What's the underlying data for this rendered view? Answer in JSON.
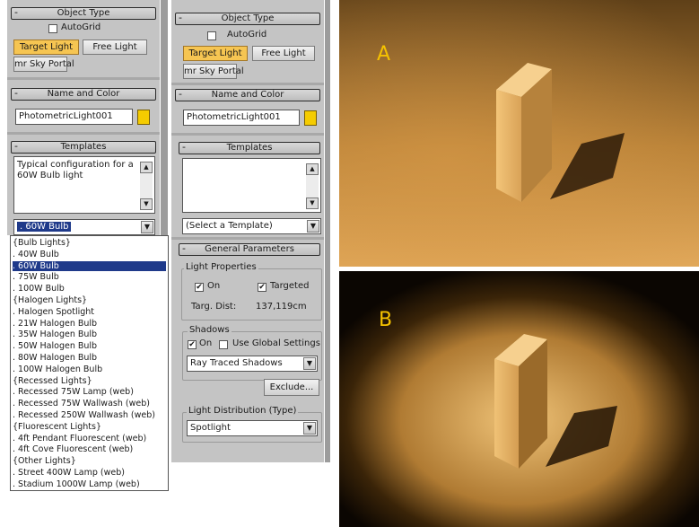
{
  "panel_left": {
    "object_type": {
      "title": "Object Type",
      "autogrid": "AutoGrid",
      "target_light": "Target Light",
      "free_light": "Free Light",
      "mr_sky_portal": "mr Sky Portal"
    },
    "name_color": {
      "title": "Name and Color",
      "name": "PhotometricLight001",
      "color": "#f5cc00"
    },
    "templates": {
      "title": "Templates",
      "description": "Typical configuration for a 60W Bulb light",
      "selected": ".  60W Bulb"
    },
    "dropdown": [
      [
        "{Bulb Lights}",
        false
      ],
      [
        ".  40W Bulb",
        false
      ],
      [
        ".  60W Bulb",
        true
      ],
      [
        ".  75W Bulb",
        false
      ],
      [
        ".  100W Bulb",
        false
      ],
      [
        "{Halogen Lights}",
        false
      ],
      [
        ".  Halogen Spotlight",
        false
      ],
      [
        ".  21W Halogen Bulb",
        false
      ],
      [
        ".  35W Halogen Bulb",
        false
      ],
      [
        ".  50W Halogen Bulb",
        false
      ],
      [
        ".  80W Halogen Bulb",
        false
      ],
      [
        ".  100W Halogen Bulb",
        false
      ],
      [
        "{Recessed Lights}",
        false
      ],
      [
        ".  Recessed 75W Lamp (web)",
        false
      ],
      [
        ".  Recessed 75W Wallwash (web)",
        false
      ],
      [
        ".  Recessed 250W Wallwash (web)",
        false
      ],
      [
        "{Fluorescent Lights}",
        false
      ],
      [
        ".  4ft Pendant Fluorescent (web)",
        false
      ],
      [
        ".  4ft Cove Fluorescent (web)",
        false
      ],
      [
        "{Other Lights}",
        false
      ],
      [
        ".  Street 400W Lamp (web)",
        false
      ],
      [
        ".  Stadium 1000W Lamp (web)",
        false
      ]
    ]
  },
  "panel_right": {
    "object_type": {
      "title": "Object Type",
      "autogrid": "AutoGrid",
      "target_light": "Target Light",
      "free_light": "Free Light",
      "mr_sky_portal": "mr Sky Portal"
    },
    "name_color": {
      "title": "Name and Color",
      "name": "PhotometricLight001",
      "color": "#f5cc00"
    },
    "templates": {
      "title": "Templates",
      "selected": "(Select a Template)"
    },
    "general": {
      "title": "General Parameters",
      "light_properties": "Light Properties",
      "on": "On",
      "targeted": "Targeted",
      "targ_dist_label": "Targ. Dist:",
      "targ_dist_value": "137,119cm",
      "shadows": "Shadows",
      "shadows_on": "On",
      "use_global": "Use Global Settings",
      "shadow_type": "Ray Traced Shadows",
      "exclude": "Exclude...",
      "light_distribution": "Light Distribution (Type)",
      "distribution_value": "Spotlight"
    }
  },
  "render_a": {
    "label": "A"
  },
  "render_b": {
    "label": "B"
  }
}
